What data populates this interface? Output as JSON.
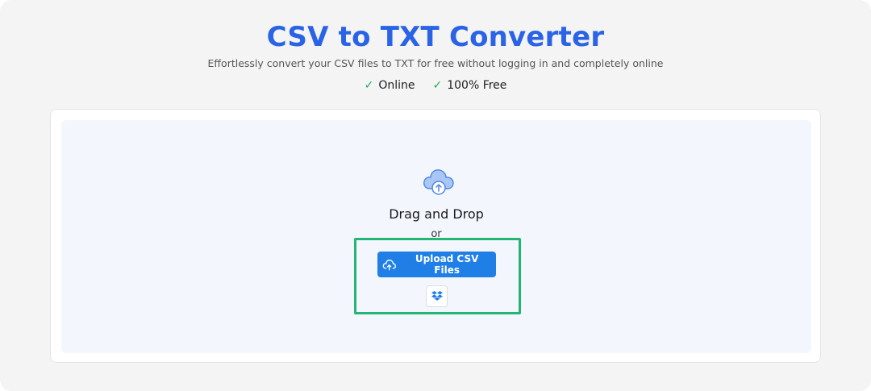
{
  "header": {
    "title": "CSV to TXT Converter",
    "subtitle": "Effortlessly convert your CSV files to TXT for free without logging in and completely online",
    "features": [
      {
        "check": "✓",
        "label": "Online"
      },
      {
        "check": "✓",
        "label": "100% Free"
      }
    ]
  },
  "dropzone": {
    "icon": "cloud-upload-icon",
    "drag_text": "Drag and Drop",
    "or_text": "or",
    "upload_button_label": "Upload CSV Files",
    "upload_button_icon": "cloud-upload-icon",
    "dropbox_icon": "dropbox-icon"
  },
  "colors": {
    "accent": "#2a63e6",
    "button": "#1f7fe6",
    "check": "#1fa85b",
    "highlight": "#22b573",
    "dropzone_bg": "#f3f7fd"
  }
}
